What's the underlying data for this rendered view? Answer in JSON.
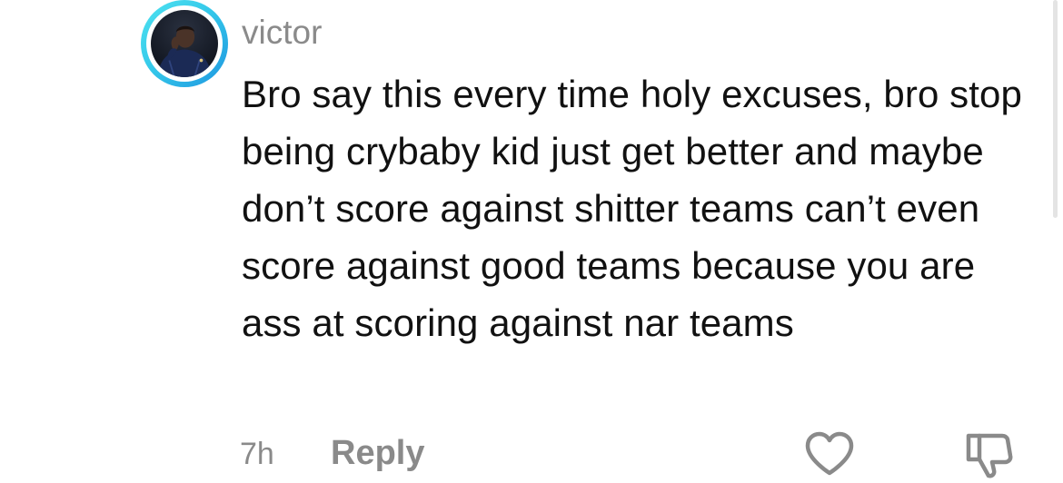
{
  "comment": {
    "username": "victor",
    "text": "Bro say this every time holy excuses, bro stop being crybaby kid just get better and maybe don’t score against shitter teams can’t even score against good teams because you are ass at scoring against nar teams",
    "timestamp": "7h",
    "reply_label": "Reply",
    "avatar_ring_colors": [
      "#4fe3f0",
      "#1e96e0"
    ]
  },
  "icons": {
    "like": "heart-outline-icon",
    "dislike": "thumbs-down-outline-icon"
  },
  "colors": {
    "text_primary": "#111111",
    "text_secondary": "#8a8a8a",
    "background": "#ffffff"
  }
}
